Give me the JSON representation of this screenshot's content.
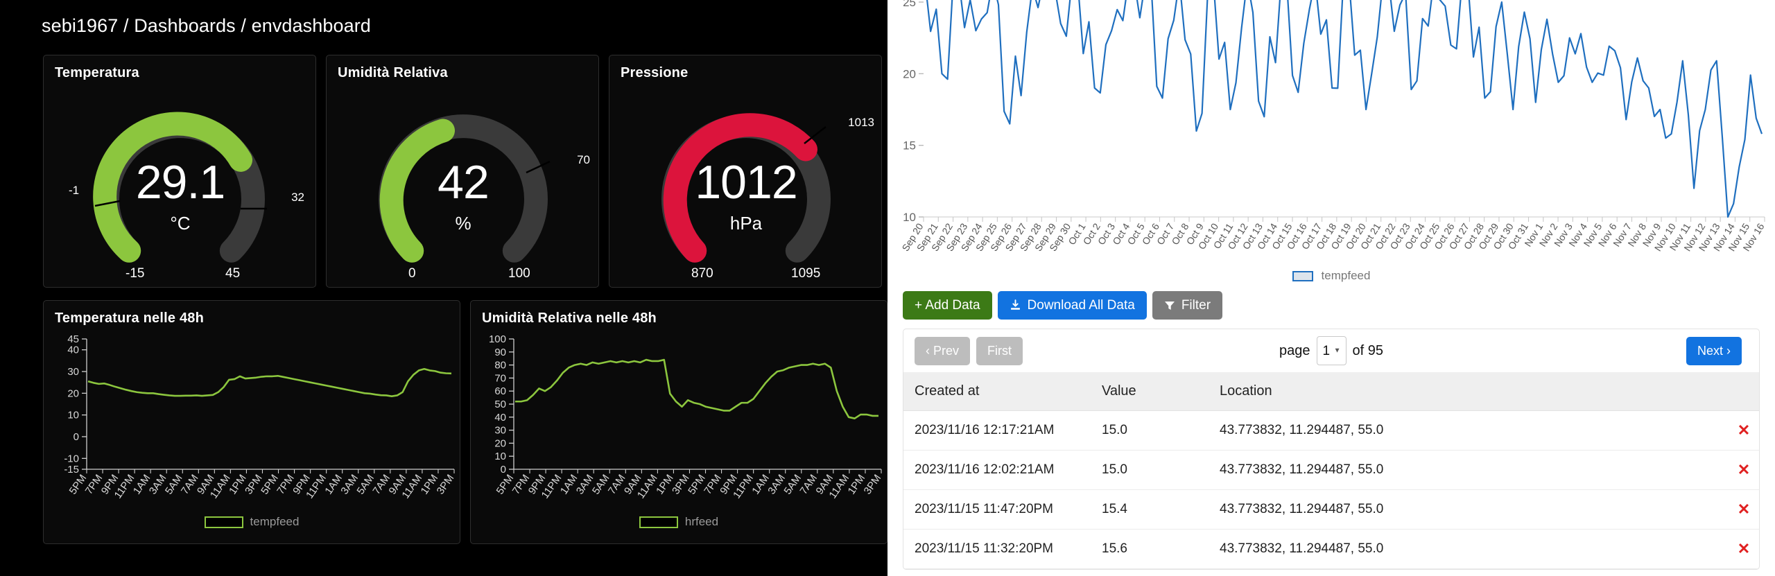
{
  "breadcrumb": "sebi1967 / Dashboards / envdashboard",
  "colors": {
    "green": "#8cc63e",
    "gauge_green": "#8cc63e",
    "gauge_red": "#dc143c",
    "gauge_track": "#3a3a3a",
    "chart_blue": "#1f6fbf",
    "btn_add": "#3c7a16",
    "btn_download": "#1273e0",
    "btn_filter": "#7b7b7b",
    "delete_red": "#e02020"
  },
  "gauges": [
    {
      "title": "Temperatura",
      "value": "29.1",
      "unit": "°C",
      "min": "-15",
      "max": "45",
      "low_threshold": "-1",
      "high_threshold": "32",
      "color": "#8cc63e",
      "min_num": -15,
      "max_num": 45,
      "value_num": 29.1,
      "low_num": -1,
      "high_num": 32
    },
    {
      "title": "Umidità Relativa",
      "value": "42",
      "unit": "%",
      "min": "0",
      "max": "100",
      "low_threshold": "",
      "high_threshold": "70",
      "color": "#8cc63e",
      "min_num": 0,
      "max_num": 100,
      "value_num": 42,
      "low_num": null,
      "high_num": 70
    },
    {
      "title": "Pressione",
      "value": "1012",
      "unit": "hPa",
      "min": "870",
      "max": "1095",
      "low_threshold": "",
      "high_threshold": "1013",
      "color": "#dc143c",
      "min_num": 870,
      "max_num": 1095,
      "value_num": 1012,
      "low_num": null,
      "high_num": 1013
    }
  ],
  "charts48": [
    {
      "title": "Temperatura nelle 48h",
      "legend": "tempfeed",
      "yticks": [
        "45",
        "40",
        "30",
        "20",
        "10",
        "0",
        "-10",
        "-15"
      ],
      "xticks": [
        "5PM",
        "7PM",
        "9PM",
        "11PM",
        "1AM",
        "3AM",
        "5AM",
        "7AM",
        "9AM",
        "11AM",
        "1PM",
        "3PM",
        "5PM",
        "7PM",
        "9PM",
        "11PM",
        "1AM",
        "3AM",
        "5AM",
        "7AM",
        "9AM",
        "11AM",
        "1PM",
        "3PM"
      ]
    },
    {
      "title": "Umidità Relativa nelle 48h",
      "legend": "hrfeed",
      "yticks": [
        "100",
        "90",
        "80",
        "70",
        "60",
        "50",
        "40",
        "30",
        "20",
        "10",
        "0"
      ],
      "xticks": [
        "5PM",
        "7PM",
        "9PM",
        "11PM",
        "1AM",
        "3AM",
        "5AM",
        "7AM",
        "9AM",
        "11AM",
        "1PM",
        "3PM",
        "5PM",
        "7PM",
        "9PM",
        "11PM",
        "1AM",
        "3AM",
        "5AM",
        "7AM",
        "9AM",
        "11AM",
        "1PM",
        "3PM"
      ]
    }
  ],
  "big_chart_legend": "tempfeed",
  "toolbar": {
    "add_label": "+ Add Data",
    "download_label": "Download All Data",
    "filter_label": "Filter"
  },
  "pager": {
    "prev_label": "‹ Prev",
    "first_label": "First",
    "next_label": "Next ›",
    "page_word": "page",
    "current_page": "1",
    "of_text": "of 95"
  },
  "table": {
    "headers": [
      "Created at",
      "Value",
      "Location"
    ],
    "rows": [
      {
        "created": "2023/11/16 12:17:21AM",
        "value": "15.0",
        "location": "43.773832, 11.294487, 55.0"
      },
      {
        "created": "2023/11/16 12:02:21AM",
        "value": "15.0",
        "location": "43.773832, 11.294487, 55.0"
      },
      {
        "created": "2023/11/15 11:47:20PM",
        "value": "15.4",
        "location": "43.773832, 11.294487, 55.0"
      },
      {
        "created": "2023/11/15 11:32:20PM",
        "value": "15.6",
        "location": "43.773832, 11.294487, 55.0"
      }
    ],
    "delete_glyph": "✕"
  },
  "chart_data": [
    {
      "type": "line",
      "name": "big-temperature-history",
      "title": "",
      "xlabel": "",
      "ylabel": "",
      "ylim": [
        10,
        26.5
      ],
      "yticks": [
        10,
        15,
        20,
        25
      ],
      "grid": false,
      "legend": "tempfeed",
      "legend_position": "bottom",
      "series": [
        {
          "name": "tempfeed",
          "color": "#1f6fbf"
        }
      ],
      "categories": [
        "Sep 20",
        "Sep 21",
        "Sep 22",
        "Sep 23",
        "Sep 24",
        "Sep 25",
        "Sep 26",
        "Sep 27",
        "Sep 28",
        "Sep 29",
        "Sep 30",
        "Oct 1",
        "Oct 2",
        "Oct 3",
        "Oct 4",
        "Oct 5",
        "Oct 6",
        "Oct 7",
        "Oct 8",
        "Oct 9",
        "Oct 10",
        "Oct 11",
        "Oct 12",
        "Oct 13",
        "Oct 14",
        "Oct 15",
        "Oct 16",
        "Oct 17",
        "Oct 18",
        "Oct 19",
        "Oct 20",
        "Oct 21",
        "Oct 22",
        "Oct 23",
        "Oct 24",
        "Oct 25",
        "Oct 26",
        "Oct 27",
        "Oct 28",
        "Oct 29",
        "Oct 30",
        "Oct 31",
        "Nov 1",
        "Nov 2",
        "Nov 3",
        "Nov 4",
        "Nov 5",
        "Nov 6",
        "Nov 7",
        "Nov 8",
        "Nov 9",
        "Nov 10",
        "Nov 11",
        "Nov 12",
        "Nov 13",
        "Nov 14",
        "Nov 15",
        "Nov 16"
      ],
      "values": [
        26.5,
        20.0,
        26.5,
        23.0,
        26.5,
        16.5,
        22.9,
        26.5,
        23.5,
        26.5,
        19.0,
        23.0,
        26.5,
        26.5,
        18.3,
        26.5,
        16.0,
        26.5,
        17.5,
        26.5,
        17.0,
        26.5,
        18.7,
        26.5,
        19.0,
        26.5,
        17.5,
        26.5,
        24.8,
        19.5,
        26.5,
        22.0,
        26.5,
        18.3,
        25.0,
        17.5,
        24.3,
        18.0,
        23.8,
        19.4,
        22.5,
        22.8,
        19.4,
        19.9,
        21.6,
        16.8,
        21.1,
        19.0,
        17.5,
        15.8,
        20.9,
        12.0,
        17.5,
        20.9,
        10.0,
        13.5,
        19.9,
        15.8
      ]
    },
    {
      "type": "line",
      "name": "temperature-48h",
      "title": "Temperatura nelle 48h",
      "legend": "tempfeed",
      "ylim": [
        -15,
        45
      ],
      "yticks": [
        45,
        40,
        30,
        20,
        10,
        0,
        -10,
        -15
      ],
      "xlabel": "",
      "ylabel": "",
      "grid": false,
      "values": [
        25.5,
        24.8,
        24.3,
        24.5,
        23.8,
        23.0,
        22.3,
        21.6,
        21.0,
        20.5,
        20.2,
        20.0,
        20.0,
        19.6,
        19.3,
        19.0,
        18.8,
        18.8,
        18.9,
        18.9,
        19.0,
        18.8,
        19.0,
        19.2,
        20.5,
        22.8,
        26.2,
        26.5,
        27.8,
        26.8,
        27.0,
        27.2,
        27.6,
        27.8,
        27.8,
        28.0,
        27.5,
        27.0,
        26.5,
        26.0,
        25.5,
        25.0,
        24.5,
        24.0,
        23.5,
        23.0,
        22.5,
        22.0,
        21.5,
        21.0,
        20.5,
        20.0,
        19.8,
        19.4,
        19.1,
        19.0,
        18.6,
        19.0,
        20.5,
        25.5,
        28.5,
        30.5,
        31.2,
        30.5,
        30.2,
        29.5,
        29.2,
        29.1
      ]
    },
    {
      "type": "line",
      "name": "humidity-48h",
      "title": "Umidità Relativa nelle 48h",
      "legend": "hrfeed",
      "ylim": [
        0,
        100
      ],
      "yticks": [
        100,
        90,
        80,
        70,
        60,
        50,
        40,
        30,
        20,
        10,
        0
      ],
      "xlabel": "",
      "ylabel": "",
      "grid": false,
      "values": [
        52,
        52,
        53,
        57,
        62,
        60,
        63,
        68,
        74,
        78,
        80,
        81,
        80,
        82,
        81,
        82,
        83,
        82,
        83,
        82,
        83,
        82,
        84,
        83,
        83,
        84,
        58,
        52,
        48,
        53,
        51,
        50,
        48,
        47,
        46,
        45,
        45,
        48,
        51,
        51,
        54,
        60,
        66,
        71,
        75,
        76,
        78,
        79,
        80,
        80,
        81,
        80,
        81,
        78,
        60,
        48,
        40,
        39,
        42,
        42,
        41,
        41
      ]
    }
  ]
}
